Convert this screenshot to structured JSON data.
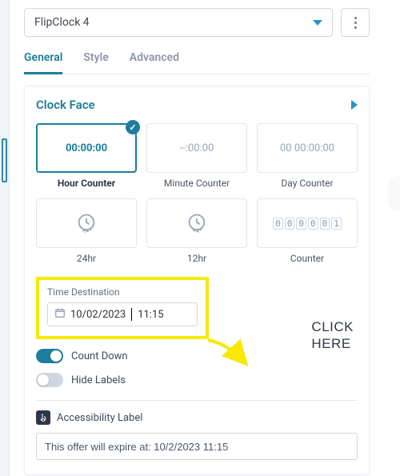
{
  "header": {
    "widget_name": "FlipClock 4"
  },
  "tabs": {
    "general": "General",
    "style": "Style",
    "advanced": "Advanced"
  },
  "section": {
    "clock_face": {
      "title": "Clock Face",
      "options": [
        {
          "preview": "00:00:00",
          "label": "Hour Counter"
        },
        {
          "preview": "--:00:00",
          "label": "Minute Counter"
        },
        {
          "preview": "00 00:00:00",
          "label": "Day Counter"
        },
        {
          "icon": "clock-24",
          "label": "24hr"
        },
        {
          "icon": "clock-12",
          "label": "12hr"
        },
        {
          "preview_digits": [
            "0",
            "0",
            "0",
            "0",
            "0",
            "1"
          ],
          "label": "Counter"
        }
      ],
      "time_destination": {
        "label": "Time Destination",
        "value_before": "10/02/2023",
        "value_after": "11:15"
      },
      "count_down": {
        "label": "Count Down",
        "on": true
      },
      "hide_labels": {
        "label": "Hide Labels",
        "on": false
      },
      "accessibility": {
        "label": "Accessibility Label",
        "value": "This offer will expire at: 10/2/2023 11:15"
      }
    }
  },
  "annotation": {
    "line1": "CLICK",
    "line2": "HERE"
  },
  "icons": {
    "check": "✓",
    "wheelchair": "♿"
  }
}
